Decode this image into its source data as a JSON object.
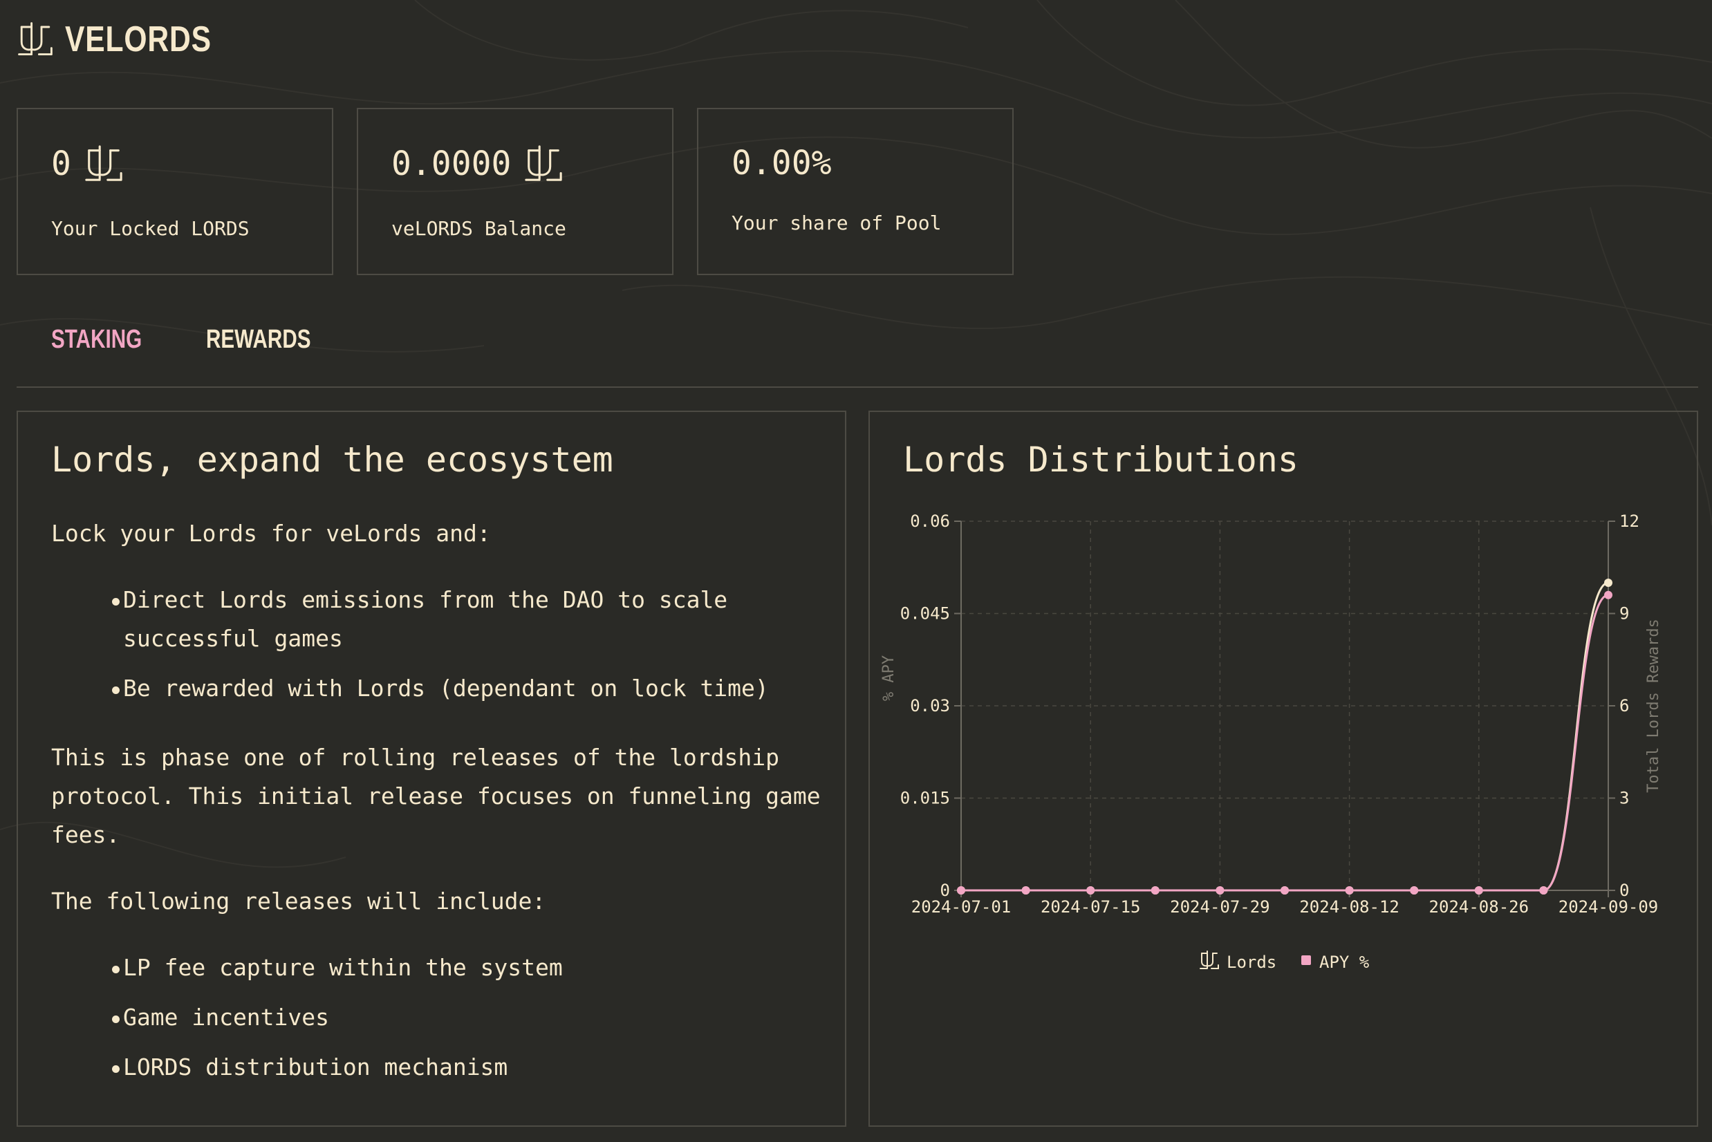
{
  "brand": {
    "title": "VELORDS",
    "logo_icon": "lords-icon"
  },
  "stats": [
    {
      "value": "0",
      "label": "Your Locked LORDS",
      "icon": "lords-icon"
    },
    {
      "value": "0.0000",
      "label": "veLORDS Balance",
      "icon": "lords-icon"
    },
    {
      "value": "0.00%",
      "label": "Your share of Pool"
    }
  ],
  "tabs": [
    {
      "label": "STAKING",
      "active": true
    },
    {
      "label": "REWARDS",
      "active": false
    }
  ],
  "info": {
    "title": "Lords, expand the ecosystem",
    "intro": "Lock your Lords for veLords and:",
    "benefits": [
      {
        "line1": "Direct Lords emissions from the DAO to scale",
        "line2": "successful games"
      },
      {
        "line1": "Be rewarded with Lords (dependant on lock time)",
        "line2": ""
      }
    ],
    "phase_line1": "This is phase one of rolling releases of the lordship",
    "phase_line2": "protocol. This initial release focuses on funneling game",
    "phase_line3": "fees.",
    "following": "The following releases will include:",
    "releases": [
      "LP fee capture within the system",
      "Game incentives",
      "LORDS distribution mechanism"
    ]
  },
  "chart_panel": {
    "title": "Lords Distributions"
  },
  "chart_data": {
    "type": "line",
    "x": [
      "2024-07-01",
      "2024-07-08",
      "2024-07-15",
      "2024-07-22",
      "2024-07-29",
      "2024-08-05",
      "2024-08-12",
      "2024-08-19",
      "2024-08-26",
      "2024-09-02",
      "2024-09-09"
    ],
    "x_tick_labels": [
      "2024-07-01",
      "2024-07-15",
      "2024-07-29",
      "2024-08-12",
      "2024-08-26",
      "2024-09-09"
    ],
    "series": [
      {
        "name": "Lords",
        "axis": "right",
        "color": "#f6e9cc",
        "values": [
          0,
          0,
          0,
          0,
          0,
          0,
          0,
          0,
          0,
          0,
          10
        ]
      },
      {
        "name": "APY %",
        "axis": "left",
        "color": "#f2a6c4",
        "values": [
          0,
          0,
          0,
          0,
          0,
          0,
          0,
          0,
          0,
          0,
          0.048
        ]
      }
    ],
    "y_left": {
      "label": "% APY",
      "ticks": [
        "0",
        "0.015",
        "0.03",
        "0.045",
        "0.06"
      ],
      "range": [
        0,
        0.06
      ]
    },
    "y_right": {
      "label": "Total Lords Rewards",
      "ticks": [
        "0",
        "3",
        "6",
        "9",
        "12"
      ],
      "range": [
        0,
        12
      ]
    },
    "grid": true,
    "legend_position": "bottom-center"
  },
  "colors": {
    "background": "#2a2a26",
    "text": "#f6e9cc",
    "accent": "#f2a6c4",
    "border": "#4d4b44",
    "muted": "#7e7b71"
  }
}
